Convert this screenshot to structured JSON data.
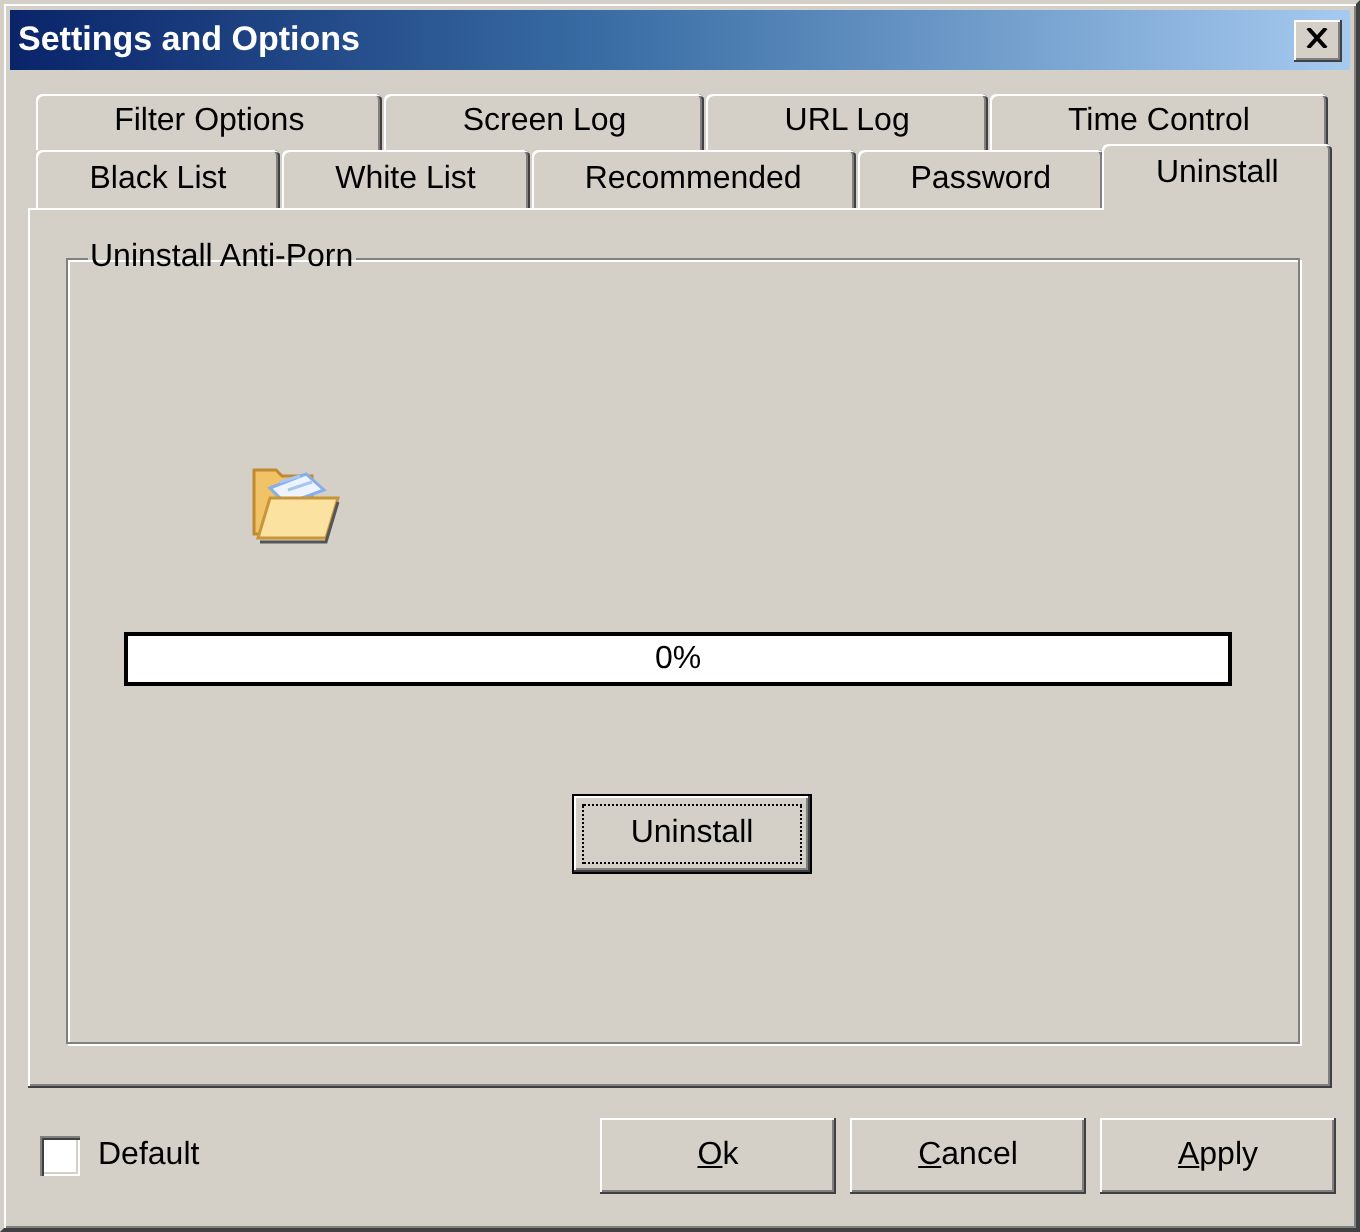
{
  "window": {
    "title": "Settings and Options"
  },
  "tab_rows": [
    {
      "tabs": [
        {
          "label": "Filter Options",
          "selected": false
        },
        {
          "label": "Screen Log",
          "selected": false
        },
        {
          "label": "URL Log",
          "selected": false
        },
        {
          "label": "Time Control",
          "selected": false
        }
      ]
    },
    {
      "tabs": [
        {
          "label": "Black List",
          "selected": false
        },
        {
          "label": "White List",
          "selected": false
        },
        {
          "label": "Recommended",
          "selected": false
        },
        {
          "label": "Password",
          "selected": false
        },
        {
          "label": "Uninstall",
          "selected": true
        }
      ]
    }
  ],
  "group": {
    "title": "Uninstall Anti-Porn",
    "progress": {
      "level": 0,
      "text": "0%"
    },
    "uninstall_button": {
      "label": "Uninstall",
      "focused": true
    }
  },
  "default_checkbox": {
    "label": "Default",
    "checked": false
  },
  "buttons": [
    {
      "label": "Ok",
      "mnemonic": true
    },
    {
      "label": "Cancel",
      "mnemonic": true
    },
    {
      "label": "Apply",
      "mnemonic": true
    }
  ]
}
